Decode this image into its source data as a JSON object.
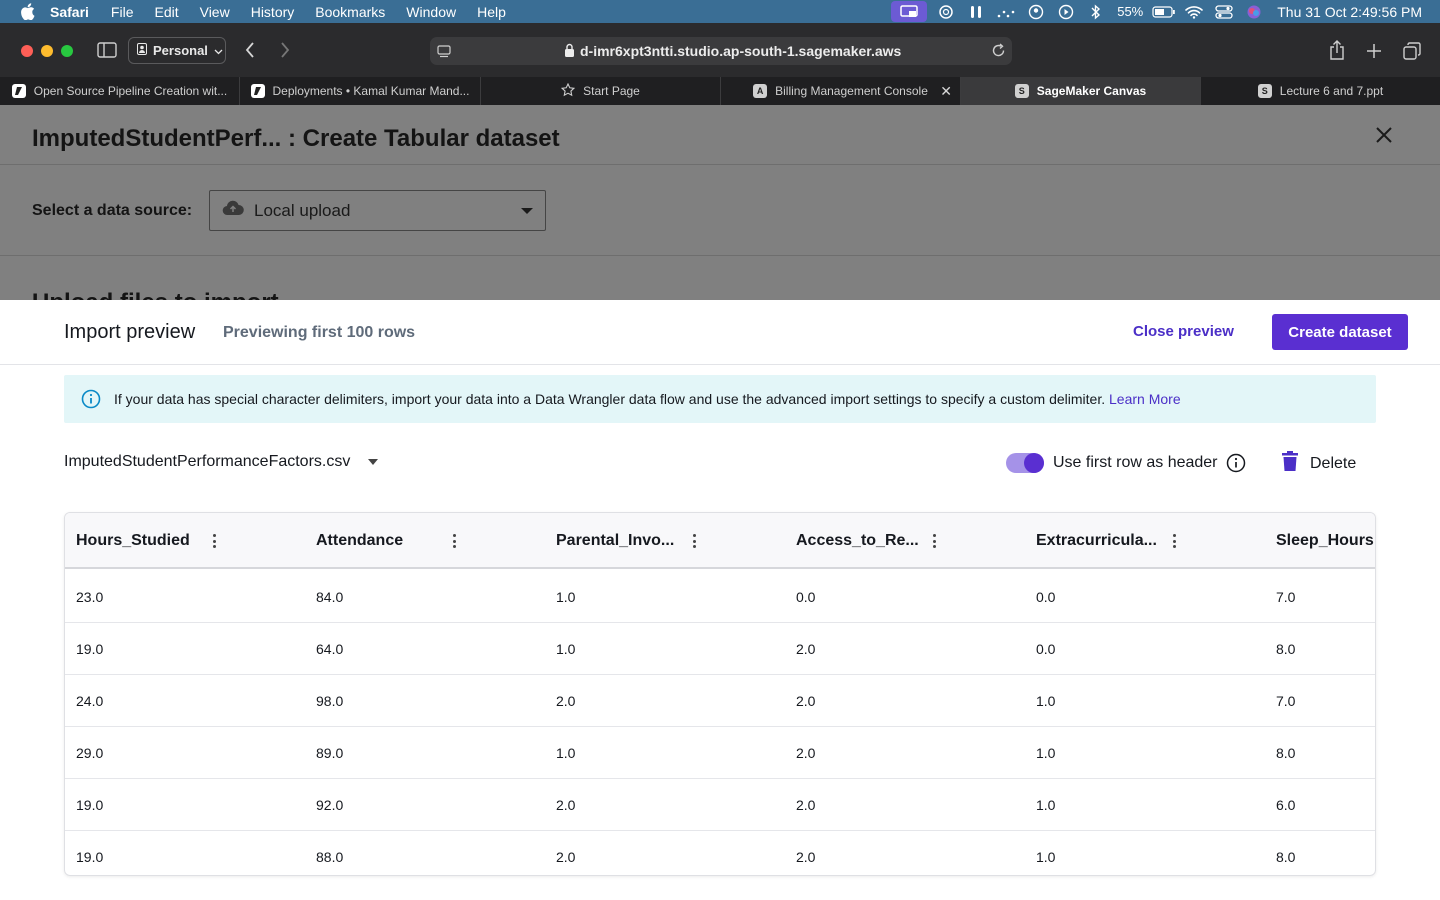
{
  "menubar": {
    "app": "Safari",
    "items": [
      "File",
      "Edit",
      "View",
      "History",
      "Bookmarks",
      "Window",
      "Help"
    ],
    "battery": "55%",
    "clock": "Thu 31 Oct  2:49:56 PM"
  },
  "browser": {
    "profile": "Personal",
    "url": "d-imr6xpt3ntti.studio.ap-south-1.sagemaker.aws",
    "tabs": [
      {
        "label": "Open Source Pipeline Creation wit...",
        "fav": ""
      },
      {
        "label": "Deployments • Kamal Kumar Mand...",
        "fav": ""
      },
      {
        "label": "Start Page",
        "fav": ""
      },
      {
        "label": "Billing Management Console",
        "fav": "A"
      },
      {
        "label": "SageMaker Canvas",
        "fav": "S"
      },
      {
        "label": "Lecture 6 and 7.ppt",
        "fav": "S"
      }
    ]
  },
  "page": {
    "title": "ImputedStudentPerf... : Create Tabular dataset",
    "source_label": "Select a data source:",
    "source_value": "Local upload",
    "upload_heading": "Upload files to import"
  },
  "preview": {
    "title": "Import preview",
    "subtitle": "Previewing first 100 rows",
    "close_label": "Close preview",
    "create_label": "Create dataset",
    "banner_text": "If your data has special character delimiters, import your data into a Data Wrangler data flow and use the advanced import settings to specify a custom delimiter.",
    "banner_link": "Learn More",
    "file_name": "ImputedStudentPerformanceFactors.csv",
    "toggle_label": "Use first row as header",
    "toggle_on": true,
    "delete_label": "Delete"
  },
  "table": {
    "columns": [
      "Hours_Studied",
      "Attendance",
      "Parental_Invo...",
      "Access_to_Re...",
      "Extracurricula...",
      "Sleep_Hours"
    ],
    "rows": [
      [
        "23.0",
        "84.0",
        "1.0",
        "0.0",
        "0.0",
        "7.0"
      ],
      [
        "19.0",
        "64.0",
        "1.0",
        "2.0",
        "0.0",
        "8.0"
      ],
      [
        "24.0",
        "98.0",
        "2.0",
        "2.0",
        "1.0",
        "7.0"
      ],
      [
        "29.0",
        "89.0",
        "1.0",
        "2.0",
        "1.0",
        "8.0"
      ],
      [
        "19.0",
        "92.0",
        "2.0",
        "2.0",
        "1.0",
        "6.0"
      ],
      [
        "19.0",
        "88.0",
        "2.0",
        "2.0",
        "1.0",
        "8.0"
      ]
    ]
  }
}
